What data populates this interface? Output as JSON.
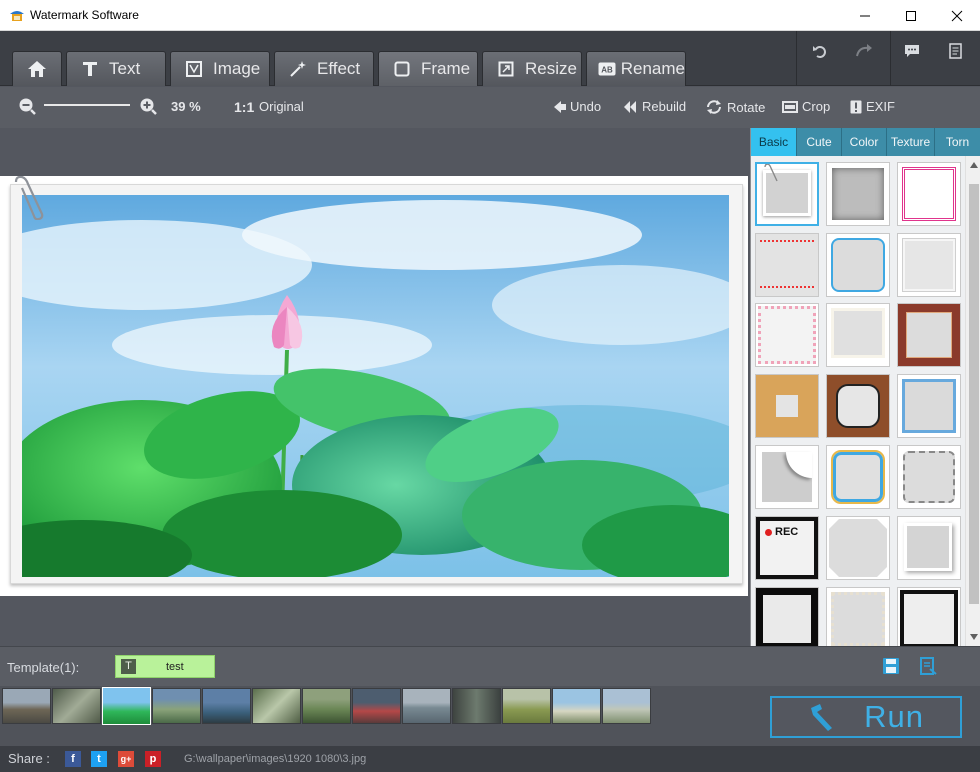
{
  "window": {
    "title": "Watermark Software"
  },
  "tabs": [
    {
      "label": "",
      "icon": "home-icon"
    },
    {
      "label": "Text",
      "icon": "text-icon"
    },
    {
      "label": "Image",
      "icon": "image-icon"
    },
    {
      "label": "Effect",
      "icon": "magic-wand-icon"
    },
    {
      "label": "Frame",
      "icon": "frame-icon"
    },
    {
      "label": "Resize",
      "icon": "resize-icon"
    },
    {
      "label": "Rename",
      "icon": "rename-icon"
    }
  ],
  "toolbar": {
    "zoom_value": "39 %",
    "original_label": "Original",
    "one_to_one": "1:1",
    "undo_label": "Undo",
    "rebuild_label": "Rebuild",
    "rotate_label": "Rotate",
    "crop_label": "Crop",
    "exif_label": "EXIF"
  },
  "frame_panel": {
    "tabs": [
      "Basic",
      "Cute",
      "Color",
      "Texture",
      "Torn"
    ],
    "active_tab": "Basic"
  },
  "template": {
    "label": "Template(1):",
    "item_name": "test",
    "item_icon": "T"
  },
  "run_label": "Run",
  "status": {
    "share_label": "Share :",
    "path": "G:\\wallpaper\\images\\1920 1080\\3.jpg"
  },
  "colors": {
    "accent": "#34c1ef",
    "run_border": "#2f9fd6",
    "template_bg": "#b9f29a"
  }
}
